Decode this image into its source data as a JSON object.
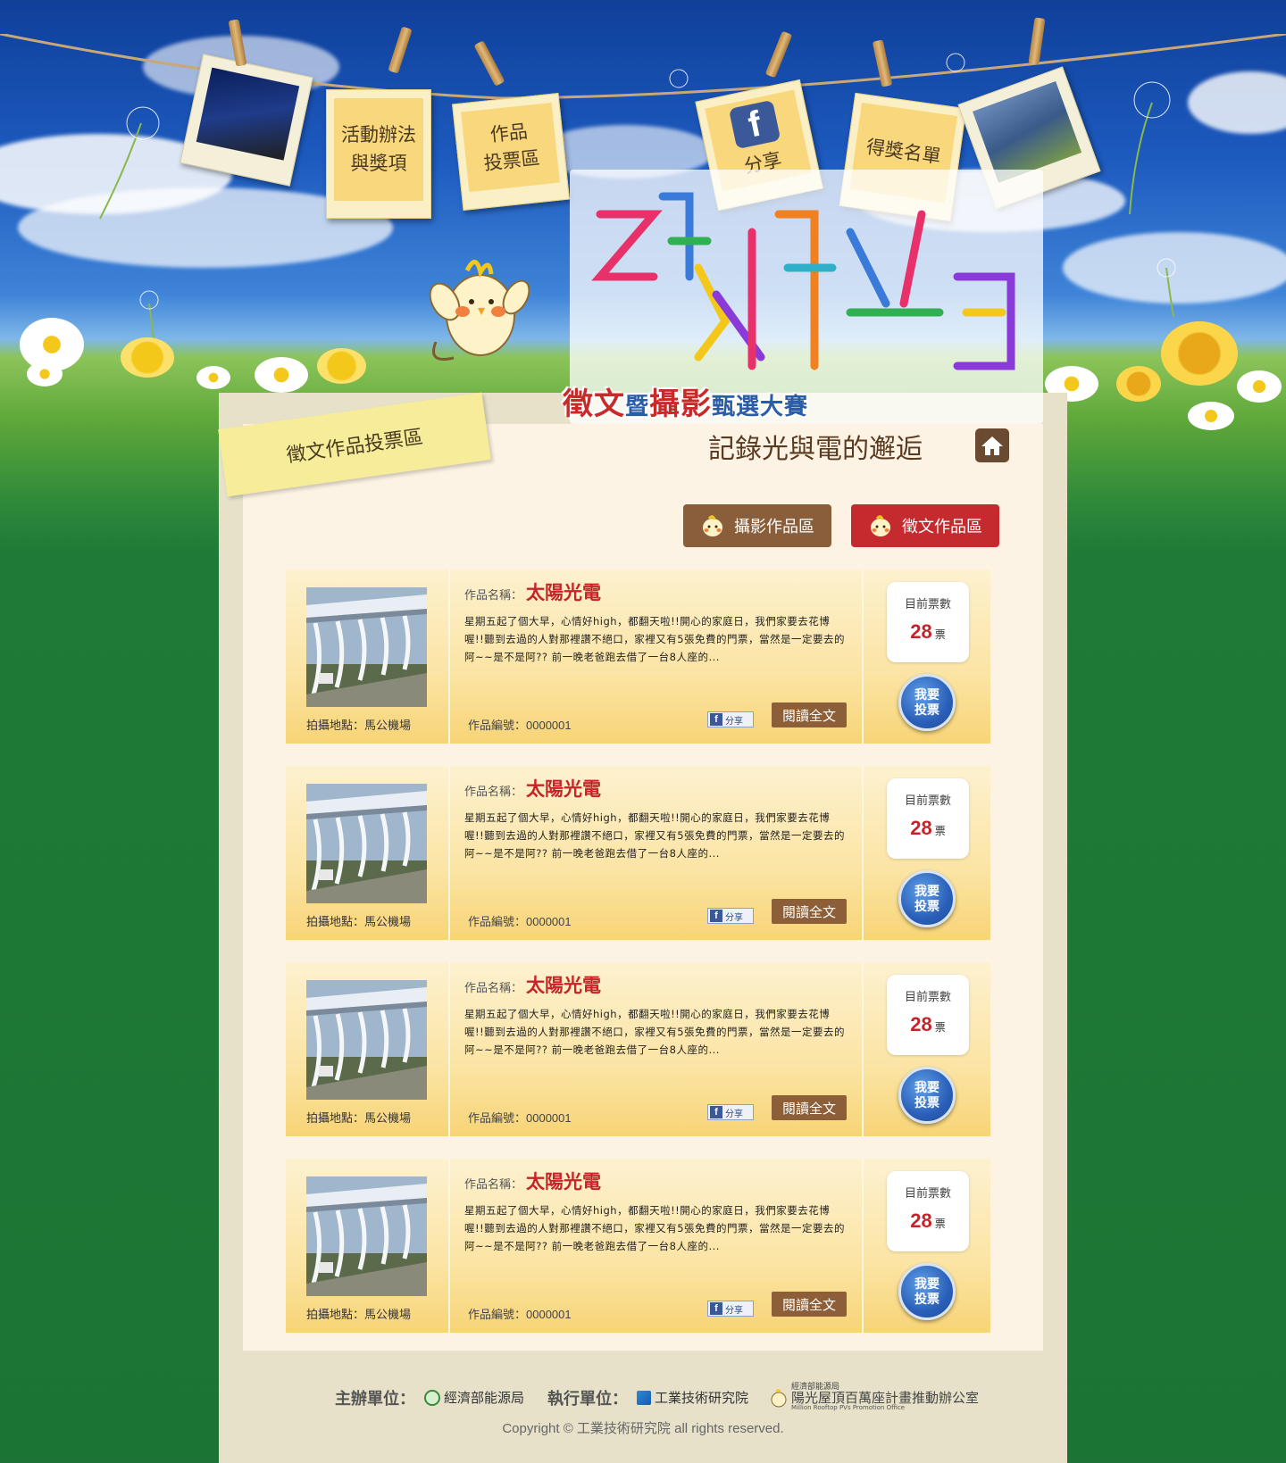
{
  "nav": {
    "rules": "活動辦法\n與獎項",
    "vote_area": "作品\n投票區",
    "share": "分享",
    "winners": "得獎名單"
  },
  "logo": {
    "title_part1": "徵文",
    "title_mid": "暨",
    "title_part2": "攝影",
    "title_part3": "甄選大賽"
  },
  "page": {
    "sticker": "徵文作品投票區",
    "tagline": "記錄光與電的邂逅"
  },
  "tabs": {
    "photo": "攝影作品區",
    "essay": "徵文作品區"
  },
  "entries": [
    {
      "name_label": "作品名稱：",
      "name": "太陽光電",
      "excerpt": "星期五起了個大早，心情好high，都翻天啦!!開心的家庭日，我們家要去花博喔!!聽到去過的人對那裡讚不絕口，家裡又有5張免費的門票，當然是一定要去的阿~~是不是阿?? 前一晚老爸跑去借了一台8人座的...",
      "location": "拍攝地點：馬公機場",
      "serial": "作品編號：0000001",
      "share": "分享",
      "read_more": "閱讀全文",
      "votes_label": "目前票數",
      "votes": "28",
      "votes_unit": "票",
      "vote_button": "我要\n投票"
    },
    {
      "name_label": "作品名稱：",
      "name": "太陽光電",
      "excerpt": "星期五起了個大早，心情好high，都翻天啦!!開心的家庭日，我們家要去花博喔!!聽到去過的人對那裡讚不絕口，家裡又有5張免費的門票，當然是一定要去的阿~~是不是阿?? 前一晚老爸跑去借了一台8人座的...",
      "location": "拍攝地點：馬公機場",
      "serial": "作品編號：0000001",
      "share": "分享",
      "read_more": "閱讀全文",
      "votes_label": "目前票數",
      "votes": "28",
      "votes_unit": "票",
      "vote_button": "我要\n投票"
    },
    {
      "name_label": "作品名稱：",
      "name": "太陽光電",
      "excerpt": "星期五起了個大早，心情好high，都翻天啦!!開心的家庭日，我們家要去花博喔!!聽到去過的人對那裡讚不絕口，家裡又有5張免費的門票，當然是一定要去的阿~~是不是阿?? 前一晚老爸跑去借了一台8人座的...",
      "location": "拍攝地點：馬公機場",
      "serial": "作品編號：0000001",
      "share": "分享",
      "read_more": "閱讀全文",
      "votes_label": "目前票數",
      "votes": "28",
      "votes_unit": "票",
      "vote_button": "我要\n投票"
    },
    {
      "name_label": "作品名稱：",
      "name": "太陽光電",
      "excerpt": "星期五起了個大早，心情好high，都翻天啦!!開心的家庭日，我們家要去花博喔!!聽到去過的人對那裡讚不絕口，家裡又有5張免費的門票，當然是一定要去的阿~~是不是阿?? 前一晚老爸跑去借了一台8人座的...",
      "location": "拍攝地點：馬公機場",
      "serial": "作品編號：0000001",
      "share": "分享",
      "read_more": "閱讀全文",
      "votes_label": "目前票數",
      "votes": "28",
      "votes_unit": "票",
      "vote_button": "我要\n投票"
    }
  ],
  "footer": {
    "organizer_label": "主辦單位：",
    "organizer": "經濟部能源局",
    "executor_label": "執行單位：",
    "executor": "工業技術研究院",
    "office_line1": "經濟部能源局",
    "office_line2": "陽光屋頂百萬座計畫推動辦公室",
    "office_line3": "Million Rooftop PVs Promotion Office",
    "copyright": "Copyright © 工業技術研究院 all rights reserved."
  },
  "colors": {
    "accent_red": "#c52a2e",
    "tab_brown": "#8a5e3a",
    "vote_blue": "#2a5fb8"
  }
}
